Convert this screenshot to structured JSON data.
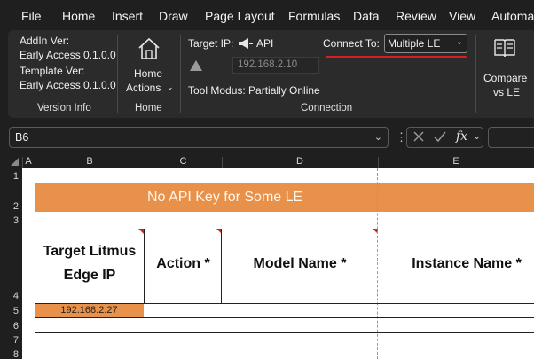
{
  "menu": {
    "tabs": [
      "File",
      "Home",
      "Insert",
      "Draw",
      "Page Layout",
      "Formulas",
      "Data",
      "Review",
      "View",
      "Automat"
    ]
  },
  "ribbon": {
    "version_info": {
      "addin_label": "AddIn Ver:",
      "addin_value": "Early Access 0.1.0.0",
      "template_label": "Template Ver:",
      "template_value": "Early Access 0.1.0.0",
      "group_title": "Version Info"
    },
    "home": {
      "button_line1": "Home",
      "button_line2": "Actions",
      "group_title": "Home"
    },
    "connection": {
      "target_ip_label": "Target IP:",
      "api_label": "API",
      "ip_value": "192.168.2.10",
      "connect_to_label": "Connect To:",
      "connect_to_value": "Multiple LE",
      "tool_modus": "Tool Modus: Partially Online",
      "group_title": "Connection"
    },
    "compare": {
      "line1": "Compare",
      "line2": "vs LE"
    }
  },
  "formula_bar": {
    "name_box": "B6",
    "fx_label": "fx",
    "formula_value": ""
  },
  "grid": {
    "columns": [
      "A",
      "B",
      "C",
      "D",
      "E"
    ],
    "rows": [
      "1",
      "2",
      "3",
      "4",
      "5",
      "6",
      "7",
      "8"
    ],
    "banner": "No API Key for Some LE",
    "headers": {
      "target_line1": "Target Litmus",
      "target_line2": "Edge IP",
      "action": "Action *",
      "model": "Model Name *",
      "instance": "Instance Name *"
    },
    "b5_value": "192.168.2.27"
  },
  "colors": {
    "accent_orange": "#e8914a",
    "red_underline": "#d81e1e",
    "ribbon_bg": "#2b2b2b"
  }
}
